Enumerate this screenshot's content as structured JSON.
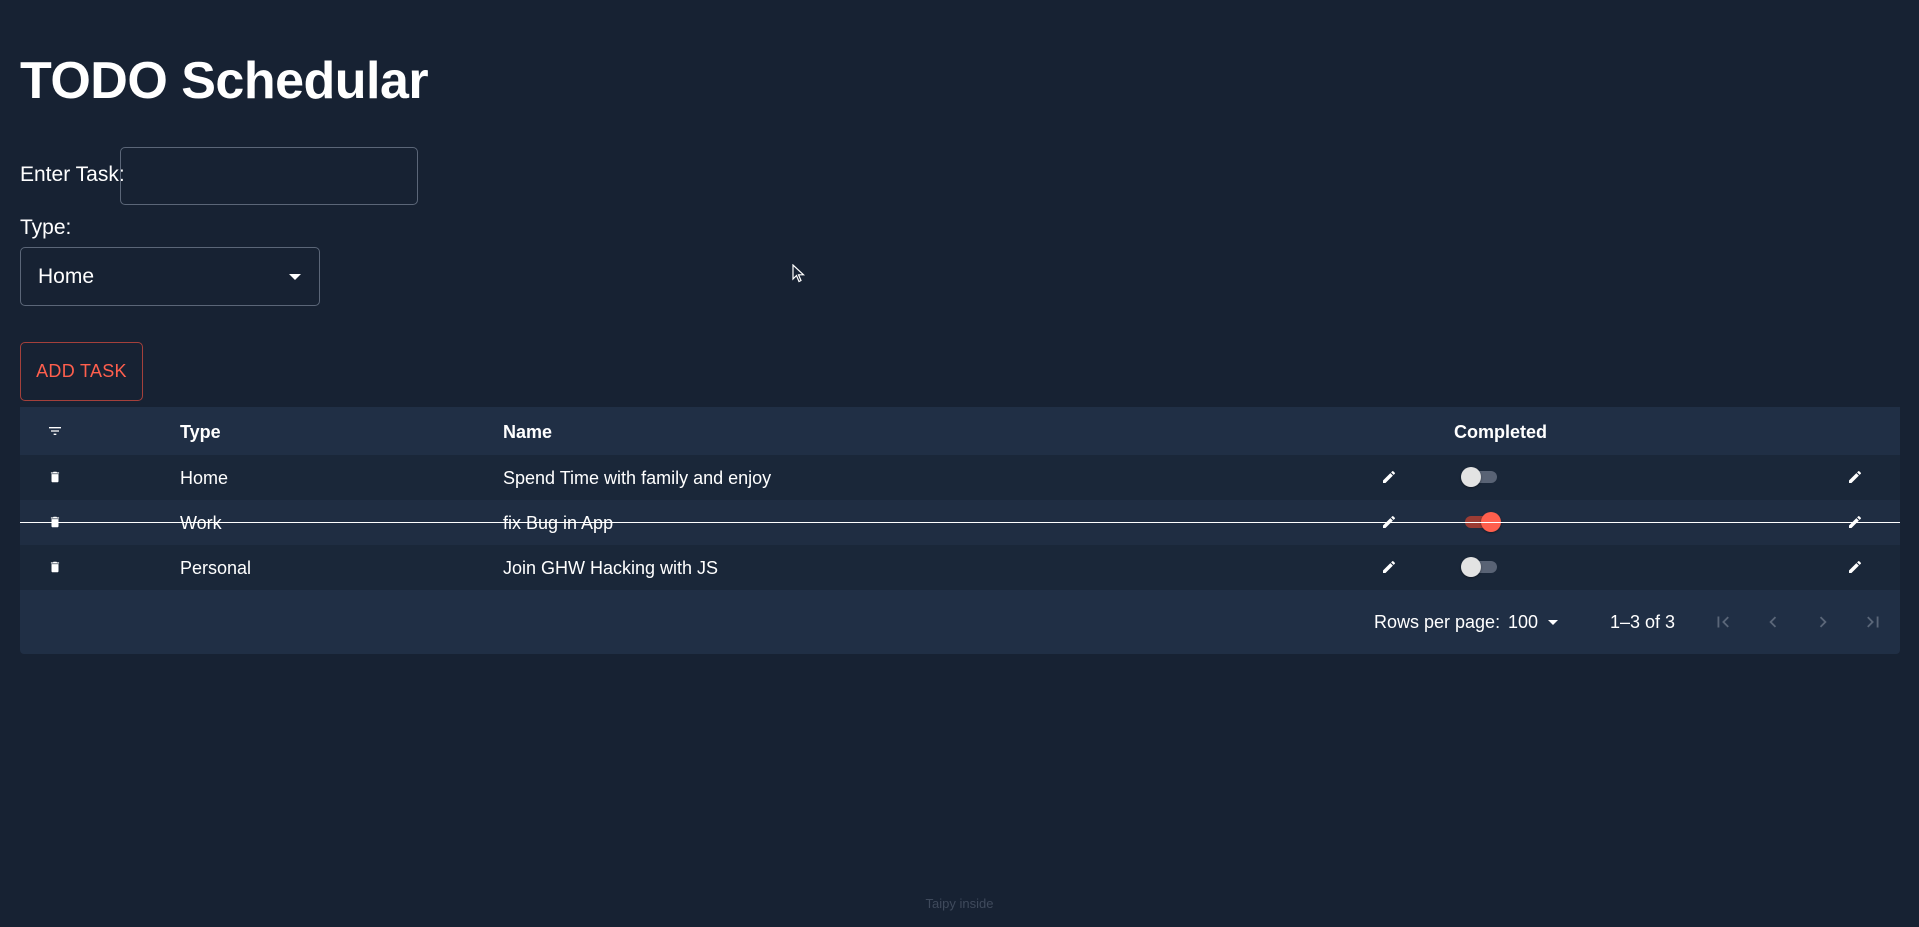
{
  "page": {
    "title": "TODO Schedular",
    "footer": "Taipy inside"
  },
  "form": {
    "task_label": "Enter Task:",
    "task_value": "",
    "type_label": "Type:",
    "type_value": "Home",
    "add_button_label": "ADD TASK"
  },
  "table": {
    "columns": {
      "filter_icon": "filter-icon",
      "type": "Type",
      "name": "Name",
      "completed": "Completed"
    },
    "rows": [
      {
        "type": "Home",
        "name": "Spend Time with family and enjoy",
        "completed": false
      },
      {
        "type": "Work",
        "name": "fix Bug in App",
        "completed": true
      },
      {
        "type": "Personal",
        "name": "Join GHW Hacking with JS",
        "completed": false
      }
    ]
  },
  "pagination": {
    "rows_per_page_label": "Rows per page:",
    "rows_per_page_value": "100",
    "range_text": "1–3 of 3"
  },
  "colors": {
    "background": "#172233",
    "table_background": "#202f45",
    "accent": "#ff5f4d"
  }
}
